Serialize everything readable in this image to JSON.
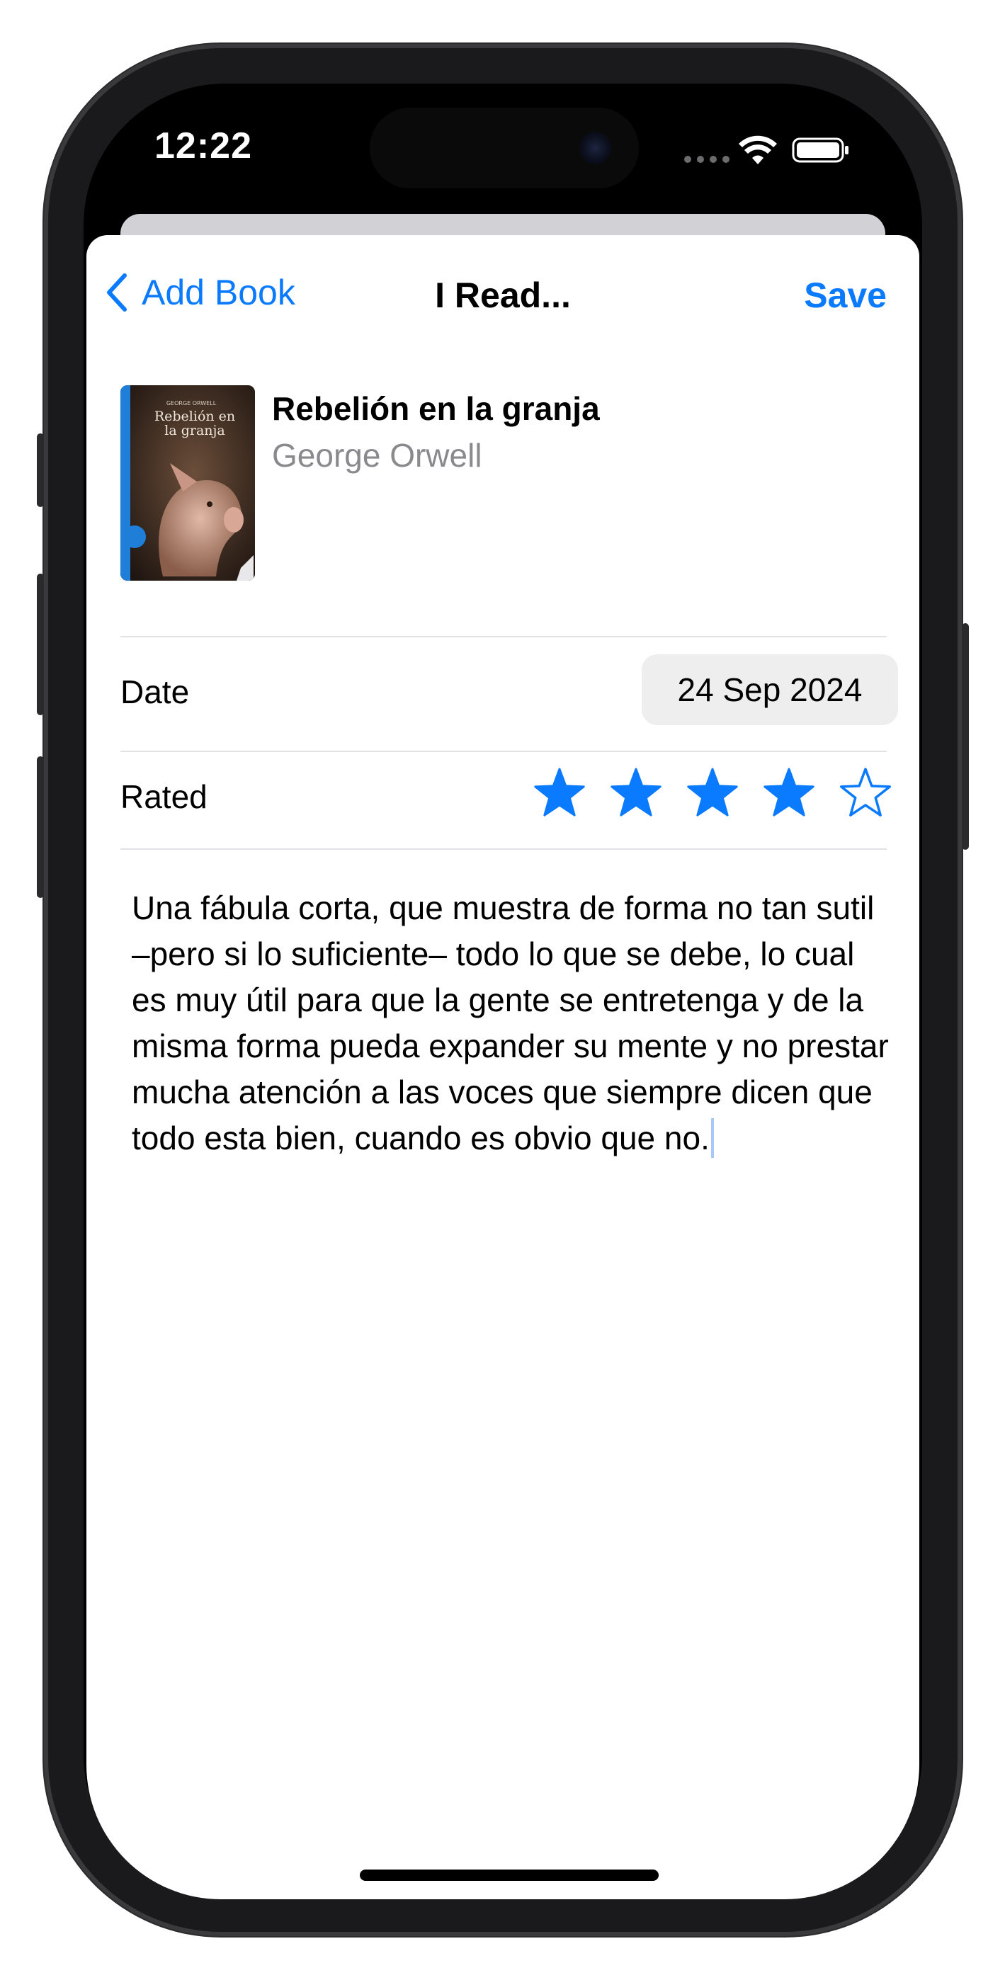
{
  "status_bar": {
    "time": "12:22"
  },
  "nav": {
    "back_label": "Add Book",
    "title": "I Read...",
    "save_label": "Save"
  },
  "book": {
    "title": "Rebelión en la granja",
    "author": "George Orwell",
    "cover": {
      "author_line": "GEORGE ORWELL",
      "title_line_1": "Rebelión en",
      "title_line_2": "la granja"
    }
  },
  "date_row": {
    "label": "Date",
    "value": "24 Sep 2024"
  },
  "rating_row": {
    "label": "Rated",
    "value": 4,
    "max": 5
  },
  "notes": {
    "text": "Una fábula corta, que muestra de forma no tan sutil –pero si lo suficiente– todo lo que se debe, lo cual es muy útil para que la gente se entretenga y de la misma forma pueda expander su mente y no prestar mucha atención a las voces que siempre dicen que todo esta bien, cuando es obvio que no."
  },
  "colors": {
    "accent": "#0a7aff",
    "secondary_text": "#8a8a8e",
    "date_pill_bg": "#eeeeef",
    "divider": "#e2e2e6"
  },
  "icons": {
    "back": "chevron-left-icon",
    "wifi": "wifi-icon",
    "battery": "battery-icon",
    "star_filled": "star-filled-icon",
    "star_empty": "star-outline-icon"
  }
}
